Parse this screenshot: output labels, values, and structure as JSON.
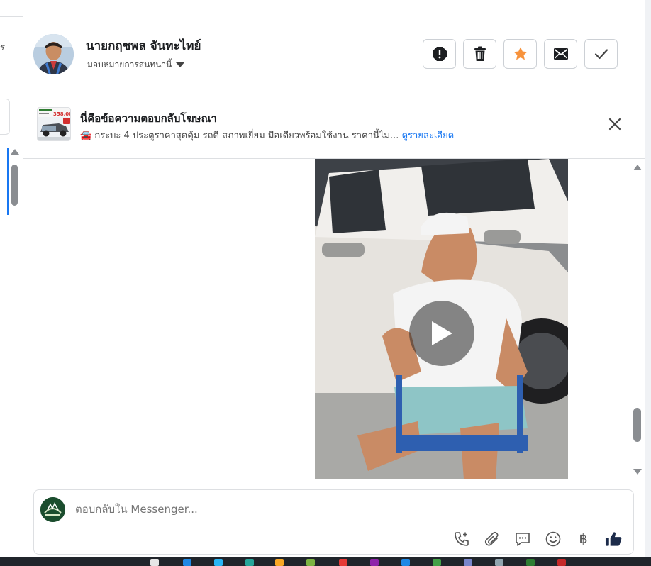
{
  "left_panel": {
    "fragment_text": "ร"
  },
  "contact": {
    "name": "นายกฤชพล จันทะไทย์",
    "assign_label": "มอบหมายการสนทนานี้"
  },
  "actions": [
    {
      "name": "spam-button",
      "icon": "alert-octagon-icon"
    },
    {
      "name": "delete-button",
      "icon": "trash-icon"
    },
    {
      "name": "star-button",
      "icon": "star-icon",
      "color": "#f7923b"
    },
    {
      "name": "mark-unread-button",
      "icon": "envelope-icon"
    },
    {
      "name": "mark-done-button",
      "icon": "check-icon"
    }
  ],
  "ad_banner": {
    "title": "นี่คือข้อความตอบกลับโฆษณา",
    "thumb_price": "358,000",
    "description": "🚘 กระบะ 4 ประตูราคาสุดคุ้ม รถดี สภาพเยี่ยม มือเดียวพร้อมใช้งาน ราคานี้ไม่...",
    "link_label": "ดูรายละเอียด",
    "close_icon": "close-icon"
  },
  "message": {
    "type": "video",
    "play_icon": "play-icon"
  },
  "composer": {
    "placeholder": "ตอบกลับใน Messenger...",
    "tools": [
      "phone-plus-icon",
      "paperclip-icon",
      "chat-bubble-icon",
      "smiley-icon",
      "baht-icon",
      "thumbs-up-icon"
    ],
    "baht_symbol": "฿"
  },
  "colors": {
    "accent": "#1877f2",
    "star": "#f7923b"
  }
}
